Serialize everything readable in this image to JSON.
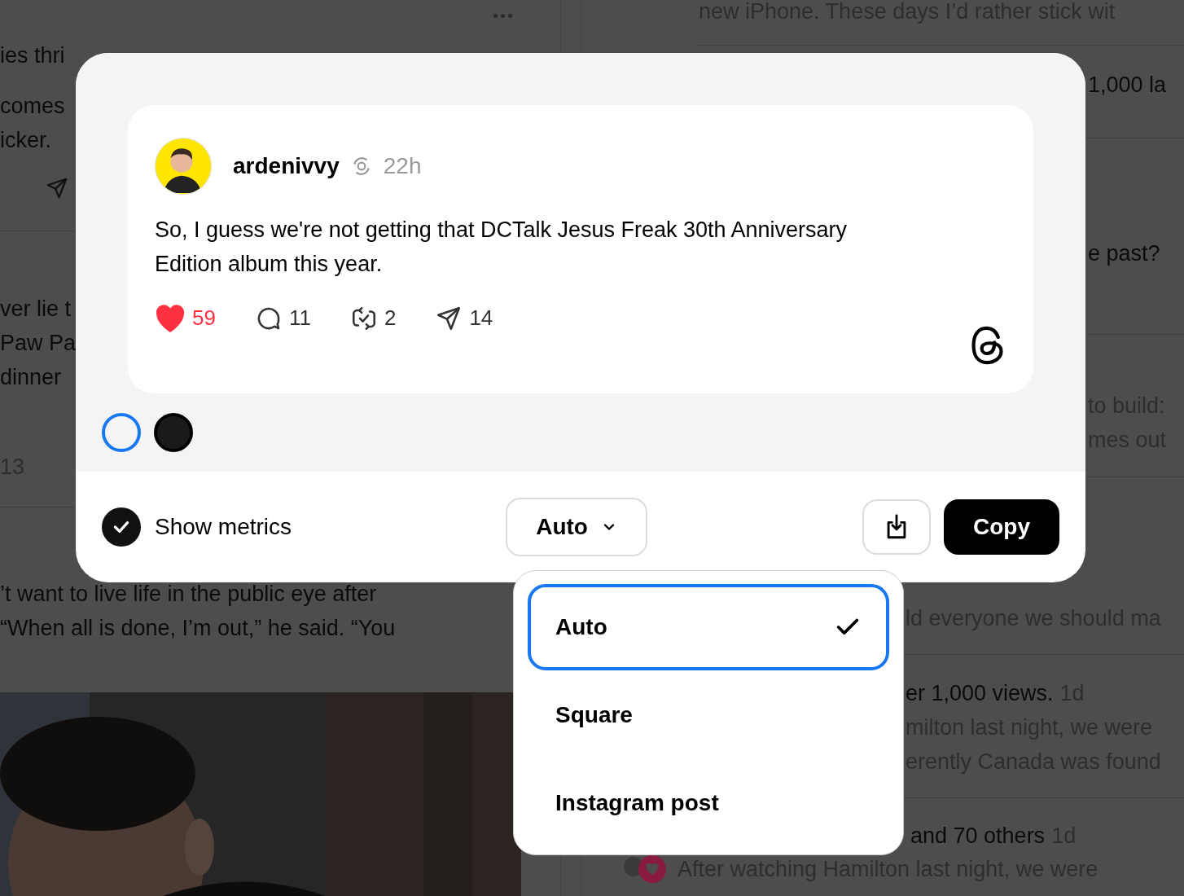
{
  "background_feed": {
    "top_line": {
      "text": "new iPhone. These days I’d rather stick wit",
      "dimmed": true
    },
    "left_fragments": [
      {
        "kind": "text",
        "text": "ies thri",
        "dimmed": false
      },
      {
        "kind": "text",
        "text": " comes",
        "dimmed": false
      },
      {
        "kind": "text",
        "text": "icker.",
        "dimmed": false
      },
      {
        "kind": "send"
      },
      {
        "kind": "text",
        "text": "ver lie t",
        "dimmed": false
      },
      {
        "kind": "text",
        "text": "Paw Pa",
        "dimmed": false
      },
      {
        "kind": "text",
        "text": "dinner",
        "dimmed": false
      },
      {
        "kind": "text",
        "text": "13",
        "dimmed": true
      }
    ],
    "left_below": [
      {
        "text": "’t want to live life in the public eye after",
        "dimmed": false
      },
      {
        "text": " “When all is done, I’m out,” he said. “You",
        "dimmed": false
      }
    ],
    "right_fragments": [
      {
        "text": "1,000 la",
        "dimmed": false
      },
      {
        "text": "e past?",
        "dimmed": false
      },
      {
        "text": "to build:",
        "dimmed": true
      },
      {
        "text": "mes out",
        "dimmed": true
      }
    ],
    "right_below": [
      {
        "text": "ld everyone we should ma",
        "dimmed": true
      },
      {
        "text": "er 1,000 views.",
        "dimmed": false,
        "time": "1d"
      },
      {
        "text": "milton last night, we were",
        "dimmed": true
      },
      {
        "text": "erently Canada was found",
        "dimmed": true
      },
      {
        "text": "and 70 others",
        "dimmed": false,
        "time": "1d"
      }
    ],
    "bottom_line": {
      "text": "After watching Hamilton last night, we were",
      "dimmed": true
    }
  },
  "share_dialog": {
    "post": {
      "username": "ardenivvy",
      "time": "22h",
      "text": "So, I guess we're not getting that DCTalk Jesus Freak 30th Anniversary Edition album this year.",
      "metrics": [
        {
          "kind": "like",
          "count": "59",
          "active": true
        },
        {
          "kind": "reply",
          "count": "11",
          "active": false
        },
        {
          "kind": "repost",
          "count": "2",
          "active": false
        },
        {
          "kind": "share",
          "count": "14",
          "active": false
        }
      ]
    },
    "themes": [
      {
        "color": "#f4f4f4",
        "selected": true
      },
      {
        "color": "#1a1a1a",
        "selected": false
      }
    ],
    "show_metrics": {
      "label": "Show metrics",
      "checked": true
    },
    "size_select": {
      "value": "Auto",
      "expanded": true
    },
    "copy_button": "Copy"
  },
  "size_menu": [
    {
      "label": "Auto",
      "selected": true
    },
    {
      "label": "Square",
      "selected": false
    },
    {
      "label": "Instagram post",
      "selected": false
    }
  ]
}
